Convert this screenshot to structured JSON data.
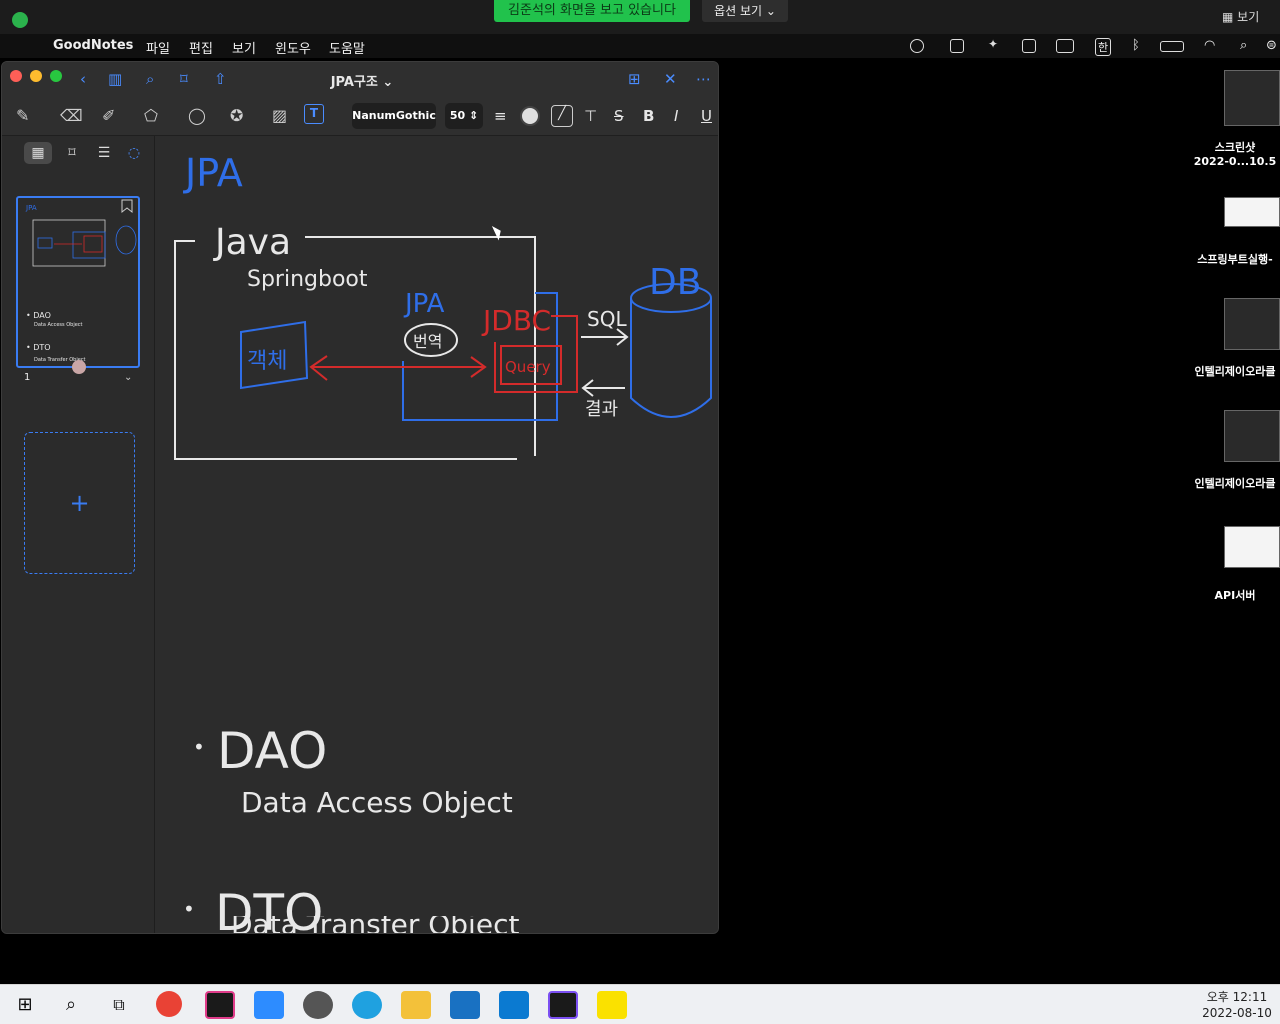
{
  "zoom": {
    "share_notice": "김준석의 화면을 보고 있습니다",
    "options_label": "옵션 보기",
    "view_label": "보기"
  },
  "mac_menu": {
    "app": "GoodNotes",
    "items": [
      "파일",
      "편집",
      "보기",
      "윈도우",
      "도움말"
    ],
    "input_lang": "한"
  },
  "goodnotes": {
    "title": "JPA구조",
    "font_name": "NanumGothic",
    "font_size": "50",
    "format": {
      "strike": "S",
      "bold": "B",
      "italic": "I",
      "underline": "U"
    },
    "page_number": "1",
    "add_page": "+"
  },
  "note": {
    "title": "JPA",
    "java": "Java",
    "springboot": "Springboot",
    "jpa": "JPA",
    "db": "DB",
    "object": "객체",
    "translate": "번역",
    "jdbc": "JDBC",
    "query": "Query",
    "sql": "SQL",
    "result": "결과",
    "dao": "DAO",
    "dao_full": "Data Access Object",
    "dto": "DTO",
    "dto_full": "Data Transfer Object"
  },
  "desktop_icons": [
    {
      "label_1": "스크린샷",
      "label_2": "2022-0...10.5"
    },
    {
      "label_1": "스프링부트실행-",
      "label_2": ""
    },
    {
      "label_1": "인텔리제이오라클",
      "label_2": ""
    },
    {
      "label_1": "인텔리제이오라클",
      "label_2": ""
    },
    {
      "label_1": "API서버",
      "label_2": ""
    }
  ],
  "taskbar": {
    "time": "오후 12:11",
    "date": "2022-08-10"
  },
  "colors": {
    "ink_blue": "#2f6ee8",
    "ink_red": "#d42b2b",
    "ink_white": "#e8e8e8",
    "accent": "#3a7cf2"
  }
}
